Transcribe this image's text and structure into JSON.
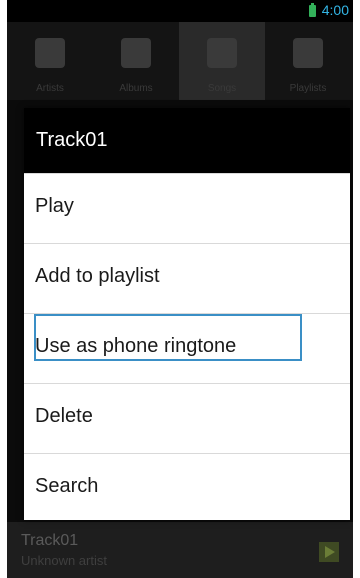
{
  "status": {
    "time": "4:00"
  },
  "tabs": [
    {
      "label": "Artists"
    },
    {
      "label": "Albums"
    },
    {
      "label": "Songs"
    },
    {
      "label": "Playlists"
    }
  ],
  "dialog": {
    "title": "Track01",
    "items": [
      {
        "label": "Play"
      },
      {
        "label": "Add to playlist"
      },
      {
        "label": "Use as phone ringtone"
      },
      {
        "label": "Delete"
      },
      {
        "label": "Search"
      }
    ]
  },
  "now_playing": {
    "title": "Track01",
    "artist": "Unknown artist"
  },
  "colors": {
    "accent": "#33b5e5",
    "highlight": "#3a8fc6",
    "battery": "#33b15a"
  }
}
